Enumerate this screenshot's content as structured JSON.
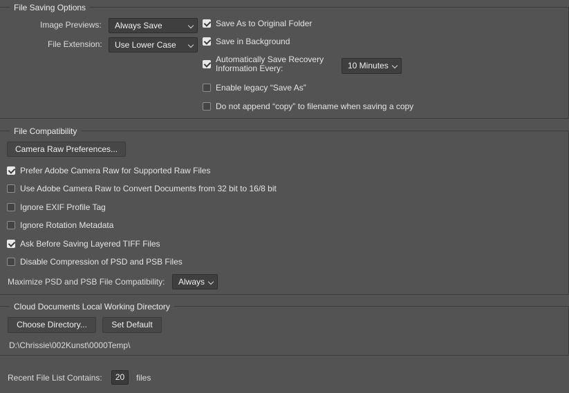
{
  "file_saving": {
    "title": "File Saving Options",
    "image_previews_label": "Image Previews:",
    "image_previews_value": "Always Save",
    "file_extension_label": "File Extension:",
    "file_extension_value": "Use Lower Case",
    "save_as_original": {
      "label": "Save As to Original Folder",
      "checked": true
    },
    "save_in_background": {
      "label": "Save in Background",
      "checked": true
    },
    "auto_save_recovery": {
      "label_line1": "Automatically Save Recovery",
      "label_line2": "Information Every:",
      "checked": true
    },
    "recovery_interval_value": "10 Minutes",
    "legacy_save_as": {
      "label": "Enable legacy “Save As”",
      "checked": false
    },
    "no_append_copy": {
      "label": "Do not append “copy” to filename when saving a copy",
      "checked": false
    }
  },
  "file_compat": {
    "title": "File Compatibility",
    "camera_raw_button": "Camera Raw Preferences...",
    "prefer_acr": {
      "label": "Prefer Adobe Camera Raw for Supported Raw Files",
      "checked": true
    },
    "acr_convert": {
      "label": "Use Adobe Camera Raw to Convert Documents from 32 bit to 16/8 bit",
      "checked": false
    },
    "ignore_exif": {
      "label": "Ignore EXIF Profile Tag",
      "checked": false
    },
    "ignore_rotation": {
      "label": "Ignore Rotation Metadata",
      "checked": false
    },
    "ask_tiff": {
      "label": "Ask Before Saving Layered TIFF Files",
      "checked": true
    },
    "disable_compression": {
      "label": "Disable Compression of PSD and PSB Files",
      "checked": false
    },
    "maximize_label": "Maximize PSD and PSB File Compatibility:",
    "maximize_value": "Always"
  },
  "cloud_docs": {
    "title": "Cloud Documents Local Working Directory",
    "choose_button": "Choose Directory...",
    "default_button": "Set Default",
    "path": "D:\\Chrissie\\002Kunst\\0000Temp\\"
  },
  "recent_files": {
    "label": "Recent File List Contains:",
    "value": "20",
    "suffix": "files"
  }
}
